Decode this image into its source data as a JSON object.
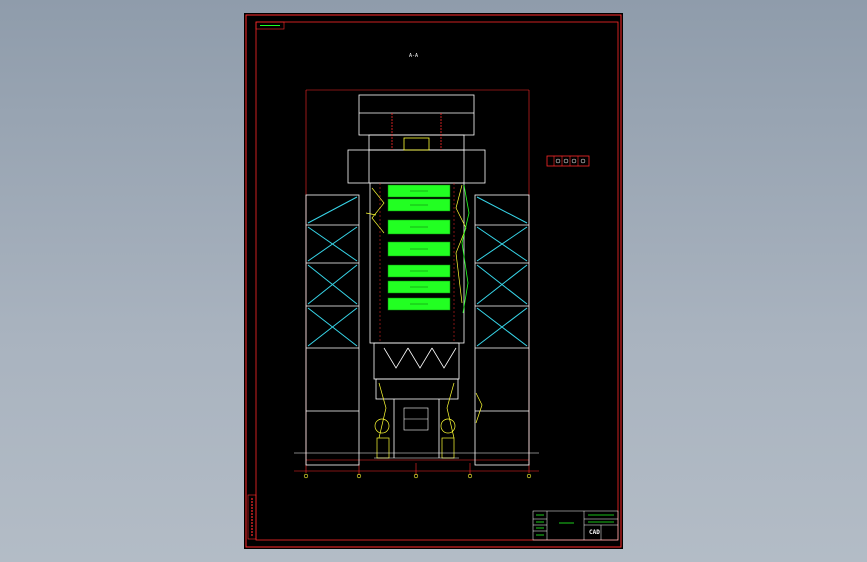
{
  "drawing": {
    "corner_tag": "",
    "section_mark": "A-A",
    "title_block": {
      "left_note": "",
      "name_lines": [
        "",
        ""
      ],
      "logo_text": "CAD"
    },
    "legend_box_text": ""
  },
  "colors": {
    "background": "#000000",
    "border": "#ff2a2a",
    "structure": "#ffffff",
    "bracing": "#37d5e8",
    "dimension": "#ff2a2a",
    "equipment": "#22ff22",
    "annotation": "#ffff33",
    "page_bg": "#9aa6b3"
  }
}
